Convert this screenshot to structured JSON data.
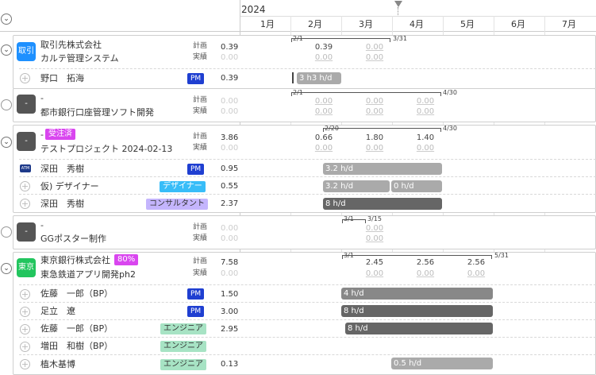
{
  "year": "2024",
  "months": [
    "1月",
    "2月",
    "3月",
    "4月",
    "5月",
    "6月",
    "7月"
  ],
  "labels": {
    "plan": "計画",
    "actual": "実績"
  },
  "projects": [
    {
      "avatar": "取引",
      "avatar_color": "#1e90ff",
      "client": "取引先株式会社",
      "name": "カルテ管理システム",
      "plan_total": "0.39",
      "actual_total": "0.00",
      "range_start": "2/1",
      "range_end": "3/31",
      "plan_months": [
        "0.39",
        "0.00"
      ],
      "actual_months": [
        "0.00",
        "0.00"
      ],
      "members": [
        {
          "name": "野口　拓海",
          "role": "PM",
          "value": "0.39",
          "bar_label": "3 h3 h/d"
        }
      ]
    },
    {
      "avatar": "-",
      "avatar_color": "#555555",
      "client": "-",
      "name": "都市銀行口座管理ソフト開発",
      "plan_total": "0.00",
      "actual_total": "0.00",
      "range_start": "2/1",
      "range_end": "4/30",
      "plan_months": [
        "0.00",
        "0.00",
        "0.00"
      ],
      "actual_months": [
        "0.00",
        "0.00",
        "0.00"
      ],
      "members": []
    },
    {
      "avatar": "-",
      "avatar_color": "#555555",
      "client": "-",
      "status": "受注済",
      "name": "テストプロジェクト 2024-02-13",
      "plan_total": "3.86",
      "actual_total": "0.00",
      "range_start": "2/20",
      "range_end": "4/30",
      "plan_months": [
        "0.66",
        "1.80",
        "1.40"
      ],
      "actual_months": [
        "0.00",
        "0.00",
        "0.00"
      ],
      "members": [
        {
          "name": "深田　秀樹",
          "role": "PM",
          "value": "0.95",
          "bar_label": "3.2 h/d",
          "avatar": "ATM"
        },
        {
          "name": "仮) デザイナー",
          "role": "デザイナー",
          "value": "0.55",
          "bar_label": "3.2 h/d",
          "bar_label2": "0 h/d"
        },
        {
          "name": "深田　秀樹",
          "role": "コンサルタント",
          "value": "2.37",
          "bar_label": "8 h/d"
        }
      ]
    },
    {
      "avatar": "-",
      "avatar_color": "#555555",
      "client": "-",
      "name": "GGポスター制作",
      "plan_total": "0.00",
      "actual_total": "0.00",
      "range_start": "3/1",
      "range_end": "3/15",
      "plan_months": [
        "0.00"
      ],
      "actual_months": [
        "0.00"
      ],
      "members": []
    },
    {
      "avatar": "東京",
      "avatar_color": "#22c55e",
      "client": "東京銀行株式会社",
      "status": "80%",
      "name": "東急鉄道アプリ開発ph2",
      "plan_total": "7.58",
      "actual_total": "0.00",
      "range_start": "3/1",
      "range_end": "5/31",
      "plan_months": [
        "2.45",
        "2.56",
        "2.56"
      ],
      "actual_months": [
        "0.00",
        "0.00",
        "0.00"
      ],
      "members": [
        {
          "name": "佐藤　一郎（BP）",
          "role": "PM",
          "value": "1.50",
          "bar_label": "4 h/d"
        },
        {
          "name": "足立　遼",
          "role": "PM",
          "value": "3.00",
          "bar_label": "8 h/d"
        },
        {
          "name": "佐藤　一郎（BP）",
          "role": "エンジニア",
          "value": "2.95",
          "bar_label": "8 h/d"
        },
        {
          "name": "増田　和樹（BP）",
          "role": "エンジニア",
          "value": "",
          "bar_label": ""
        },
        {
          "name": "植木基博",
          "role": "エンジニア",
          "value": "0.13",
          "bar_label": "0.5 h/d"
        }
      ]
    }
  ]
}
